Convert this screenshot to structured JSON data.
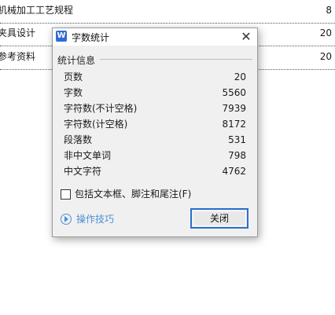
{
  "document": {
    "toc": [
      {
        "title": "机械加工工艺规程",
        "page": "8"
      },
      {
        "title": "夹具设计",
        "page": "20"
      },
      {
        "title": "参考资料",
        "page": "20"
      }
    ]
  },
  "dialog": {
    "title": "字数统计",
    "app_icon_letter": "W",
    "close_glyph": "✕",
    "group_label": "统计信息",
    "stats": [
      {
        "label": "页数",
        "value": "20"
      },
      {
        "label": "字数",
        "value": "5560"
      },
      {
        "label": "字符数(不计空格)",
        "value": "7939"
      },
      {
        "label": "字符数(计空格)",
        "value": "8172"
      },
      {
        "label": "段落数",
        "value": "531"
      },
      {
        "label": "非中文单词",
        "value": "798"
      },
      {
        "label": "中文字符",
        "value": "4762"
      }
    ],
    "checkbox_label": "包括文本框、脚注和尾注(F)",
    "checkbox_checked": false,
    "tips_label": "操作技巧",
    "close_button_label": "关闭"
  },
  "colors": {
    "accent": "#2d6fd1",
    "link": "#4a90d9",
    "dialog_bg": "#f0f0f0"
  }
}
